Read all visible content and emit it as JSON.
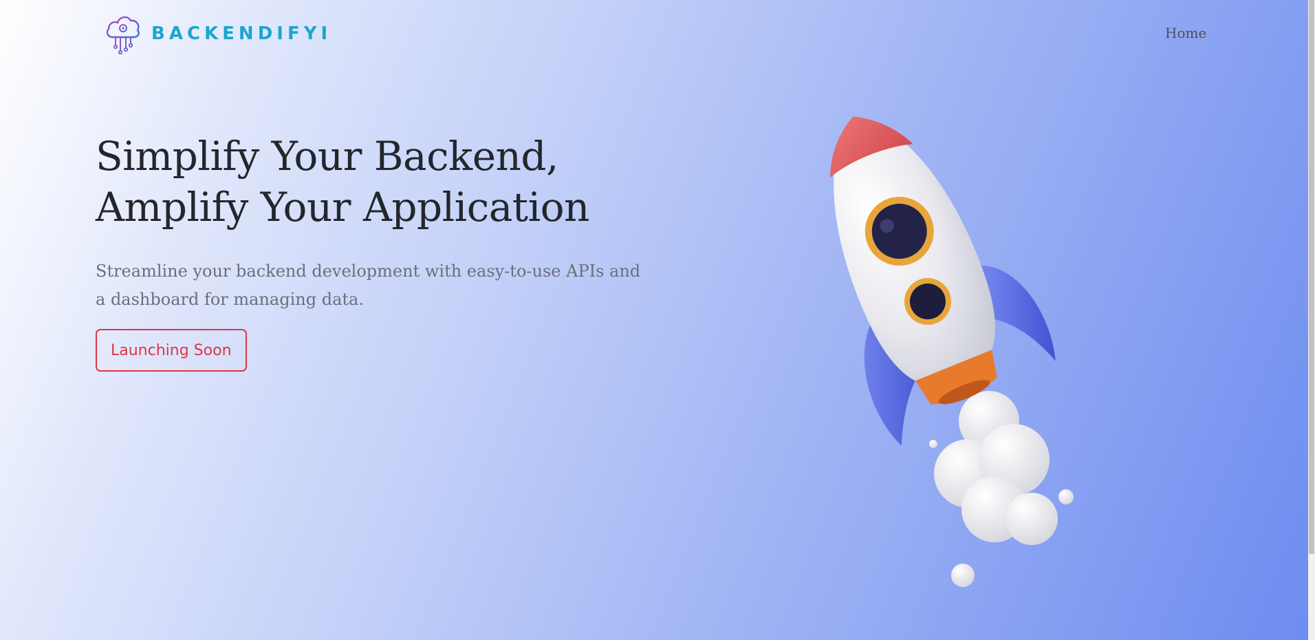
{
  "brand": {
    "name": "BACKENDIFYI",
    "logo_icon": "cloud-circuit-icon"
  },
  "nav": {
    "home": "Home"
  },
  "hero": {
    "title_line1": "Simplify Your Backend,",
    "title_line2": "Amplify Your Application",
    "lead": "Streamline your backend development with easy-to-use APIs and a dashboard for managing data.",
    "cta": "Launching Soon",
    "illustration": "rocket-illustration"
  },
  "colors": {
    "brand": "#1aa6cf",
    "cta": "#dc3545",
    "gradient_start": "#ffffff",
    "gradient_end": "#6c8cf0"
  }
}
